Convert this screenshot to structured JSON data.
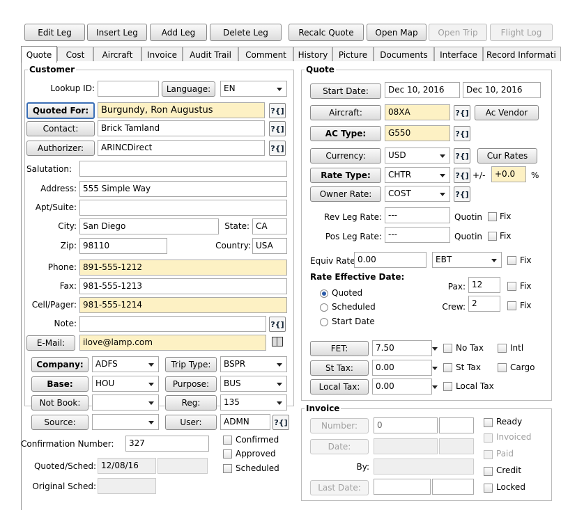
{
  "toolbar": {
    "edit_leg": "Edit Leg",
    "insert_leg": "Insert Leg",
    "add_leg": "Add Leg",
    "delete_leg": "Delete Leg",
    "recalc_quote": "Recalc Quote",
    "open_map": "Open Map",
    "open_trip": "Open Trip",
    "flight_log": "Flight Log"
  },
  "tabs": [
    "Quote",
    "Cost",
    "Aircraft",
    "Invoice",
    "Audit Trail",
    "Comment",
    "History",
    "Picture",
    "Documents",
    "Interface",
    "Record Informati"
  ],
  "customer": {
    "legend": "Customer",
    "lookup_id_label": "Lookup ID:",
    "lookup_id": "",
    "language_label": "Language:",
    "language": "EN",
    "quoted_for_label": "Quoted For:",
    "quoted_for": "Burgundy, Ron Augustus",
    "contact_label": "Contact:",
    "contact": "Brick Tamland",
    "authorizer_label": "Authorizer:",
    "authorizer": "ARINCDirect",
    "salutation_label": "Salutation:",
    "salutation": "",
    "address_label": "Address:",
    "address": "555 Simple Way",
    "apt_label": "Apt/Suite:",
    "apt": "",
    "city_label": "City:",
    "city": "San Diego",
    "state_label": "State:",
    "state": "CA",
    "zip_label": "Zip:",
    "zip": "98110",
    "country_label": "Country:",
    "country": "USA",
    "phone_label": "Phone:",
    "phone": "891-555-1212",
    "fax_label": "Fax:",
    "fax": "981-555-1213",
    "cell_label": "Cell/Pager:",
    "cell": "981-555-1214",
    "note_label": "Note:",
    "note": "",
    "email_label": "E-Mail:",
    "email": "ilove@lamp.com",
    "help_glyph": "?{]"
  },
  "company": {
    "company_label": "Company:",
    "company": "ADFS",
    "trip_type_label": "Trip Type:",
    "trip_type": "BSPR",
    "base_label": "Base:",
    "base": "HOU",
    "purpose_label": "Purpose:",
    "purpose": "BUS",
    "not_book_label": "Not Book:",
    "not_book": "",
    "reg_label": "Reg:",
    "reg": "135",
    "source_label": "Source:",
    "source": "",
    "user_label": "User:",
    "user": "ADMN",
    "confirmation_label": "Confirmation Number:",
    "confirmation": "327",
    "quoted_sched_label": "Quoted/Sched:",
    "quoted_sched": "12/08/16",
    "original_sched_label": "Original Sched:",
    "confirmed": "Confirmed",
    "approved": "Approved",
    "scheduled": "Scheduled"
  },
  "quote": {
    "legend": "Quote",
    "start_date_label": "Start Date:",
    "start_date": "Dec 10, 2016",
    "end_date": "Dec 10, 2016",
    "aircraft_label": "Aircraft:",
    "aircraft": "08XA",
    "ac_vendor": "Ac Vendor",
    "ac_type_label": "AC Type:",
    "ac_type": "G550",
    "currency_label": "Currency:",
    "currency": "USD",
    "cur_rates": "Cur Rates",
    "rate_type_label": "Rate Type:",
    "rate_type": "CHTR",
    "plus_minus": "+/-",
    "adjust": "+0.0",
    "percent": "%",
    "owner_rate_label": "Owner Rate:",
    "owner_rate": "COST",
    "rev_leg_rate_label": "Rev Leg Rate:",
    "rev_leg_rate": "---",
    "pos_leg_rate_label": "Pos Leg Rate:",
    "pos_leg_rate": "---",
    "quotin": "Quotin",
    "fix": "Fix",
    "equiv_rate_label": "Equiv Rate:",
    "equiv_rate": "0.00",
    "equiv_type": "EBT",
    "rate_eff_label": "Rate Effective Date:",
    "opt_quoted": "Quoted",
    "opt_scheduled": "Scheduled",
    "opt_start": "Start Date",
    "pax_label": "Pax:",
    "pax": "12",
    "crew_label": "Crew:",
    "crew": "2",
    "fet_label": "FET:",
    "fet": "7.50",
    "no_tax": "No Tax",
    "intl": "Intl",
    "st_tax_label": "St Tax:",
    "st_tax": "0.00",
    "st_tax_cb": "St Tax",
    "cargo": "Cargo",
    "local_tax_label": "Local Tax:",
    "local_tax": "0.00",
    "local_tax_cb": "Local Tax"
  },
  "invoice": {
    "legend": "Invoice",
    "number_label": "Number:",
    "number": "0",
    "date_label": "Date:",
    "by_label": "By:",
    "last_date_label": "Last Date:",
    "ready": "Ready",
    "invoiced": "Invoiced",
    "paid": "Paid",
    "credit": "Credit",
    "locked": "Locked"
  }
}
